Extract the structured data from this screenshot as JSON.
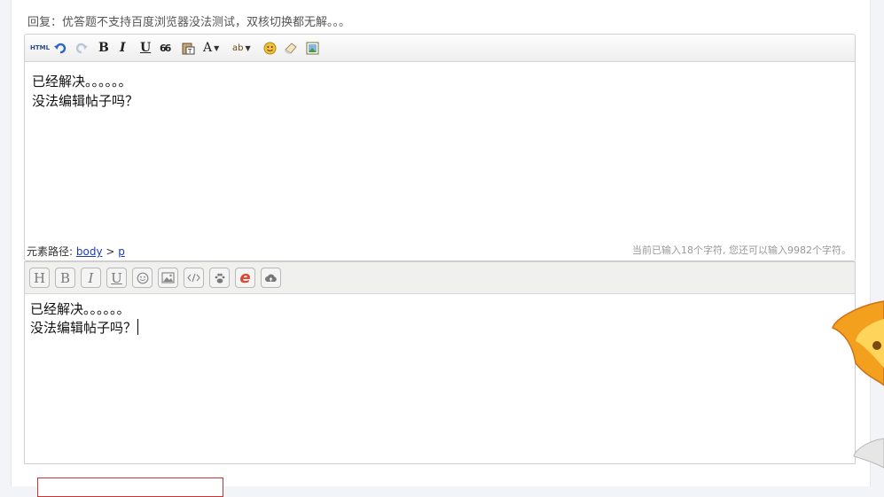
{
  "reply": {
    "text": "回复：优答题不支持百度浏览器没法测试，双核切换都无解。。。"
  },
  "editor1": {
    "toolbar": {
      "html_label": "HTML",
      "bold_label": "B",
      "italic_label": "I",
      "underline_label": "U",
      "quote_label": "66",
      "font_color_label": "A",
      "highlight_label": "ab"
    },
    "content_lines": [
      "已经解决。。。。。。",
      "没法编辑帖子吗？"
    ],
    "path_label": "元素路径:",
    "path_body": "body",
    "path_sep": ">",
    "path_p": "p",
    "char_count": "当前已输入18个字符, 您还可以输入9982个字符。"
  },
  "editor2": {
    "toolbar": {
      "heading_label": "H",
      "bold_label": "B",
      "italic_label": "I",
      "underline_label": "U",
      "ie_label": "e"
    },
    "content_lines": [
      "已经解决。。。。。。",
      "没法编辑帖子吗？"
    ]
  },
  "colors": {
    "link": "#1a3dc1",
    "ie_icon": "#e0442c",
    "submit_border": "#cc3333"
  }
}
